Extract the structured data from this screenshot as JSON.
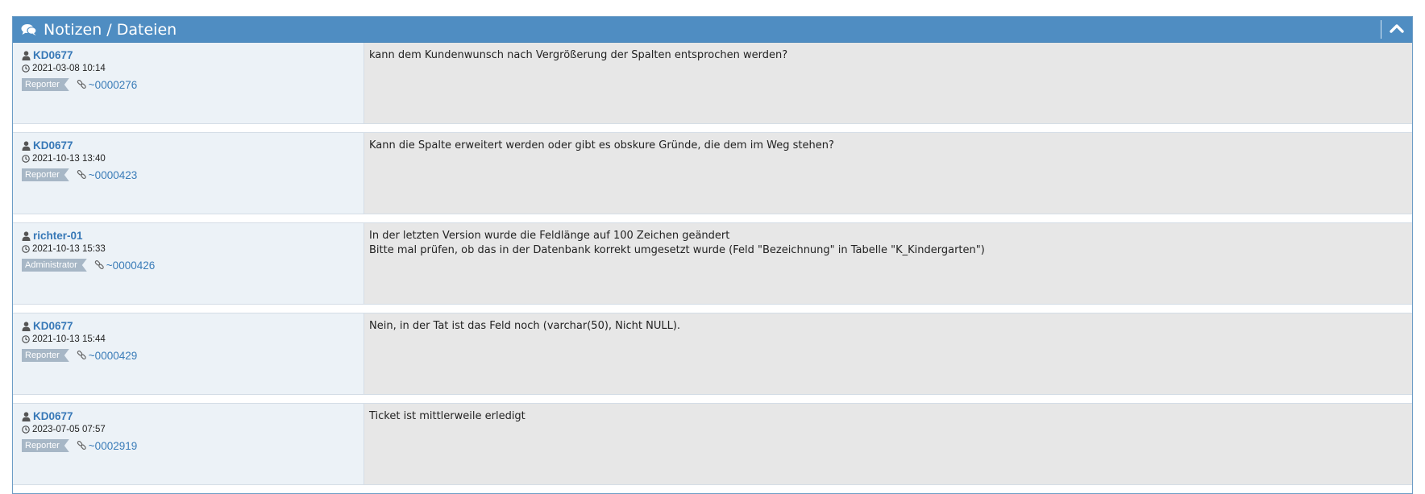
{
  "header": {
    "title": "Notizen / Dateien",
    "icon": "comments-icon",
    "collapse_icon": "chevron-up-icon"
  },
  "colors": {
    "header_bg": "#4f8dc2",
    "meta_bg": "#ecf2f7",
    "body_bg": "#e7e7e7",
    "link": "#3778b7",
    "badge_bg": "#a7b7c6"
  },
  "notes": [
    {
      "author": "KD0677",
      "date": "2021-03-08 10:14",
      "role": "Reporter",
      "ref": "~0000276",
      "text": "kann dem Kundenwunsch nach Vergrößerung der Spalten entsprochen werden?"
    },
    {
      "author": "KD0677",
      "date": "2021-10-13 13:40",
      "role": "Reporter",
      "ref": "~0000423",
      "text": "Kann die Spalte erweitert werden oder gibt es obskure Gründe, die dem im Weg stehen?"
    },
    {
      "author": "richter-01",
      "date": "2021-10-13 15:33",
      "role": "Administrator",
      "ref": "~0000426",
      "text": "In der letzten Version wurde die Feldlänge auf 100 Zeichen geändert\nBitte mal prüfen, ob das in der Datenbank korrekt umgesetzt wurde (Feld \"Bezeichnung\" in Tabelle \"K_Kindergarten\")"
    },
    {
      "author": "KD0677",
      "date": "2021-10-13 15:44",
      "role": "Reporter",
      "ref": "~0000429",
      "text": "Nein, in der Tat ist das Feld noch (varchar(50), Nicht NULL)."
    },
    {
      "author": "KD0677",
      "date": "2023-07-05 07:57",
      "role": "Reporter",
      "ref": "~0002919",
      "text": "Ticket ist mittlerweile erledigt"
    }
  ]
}
